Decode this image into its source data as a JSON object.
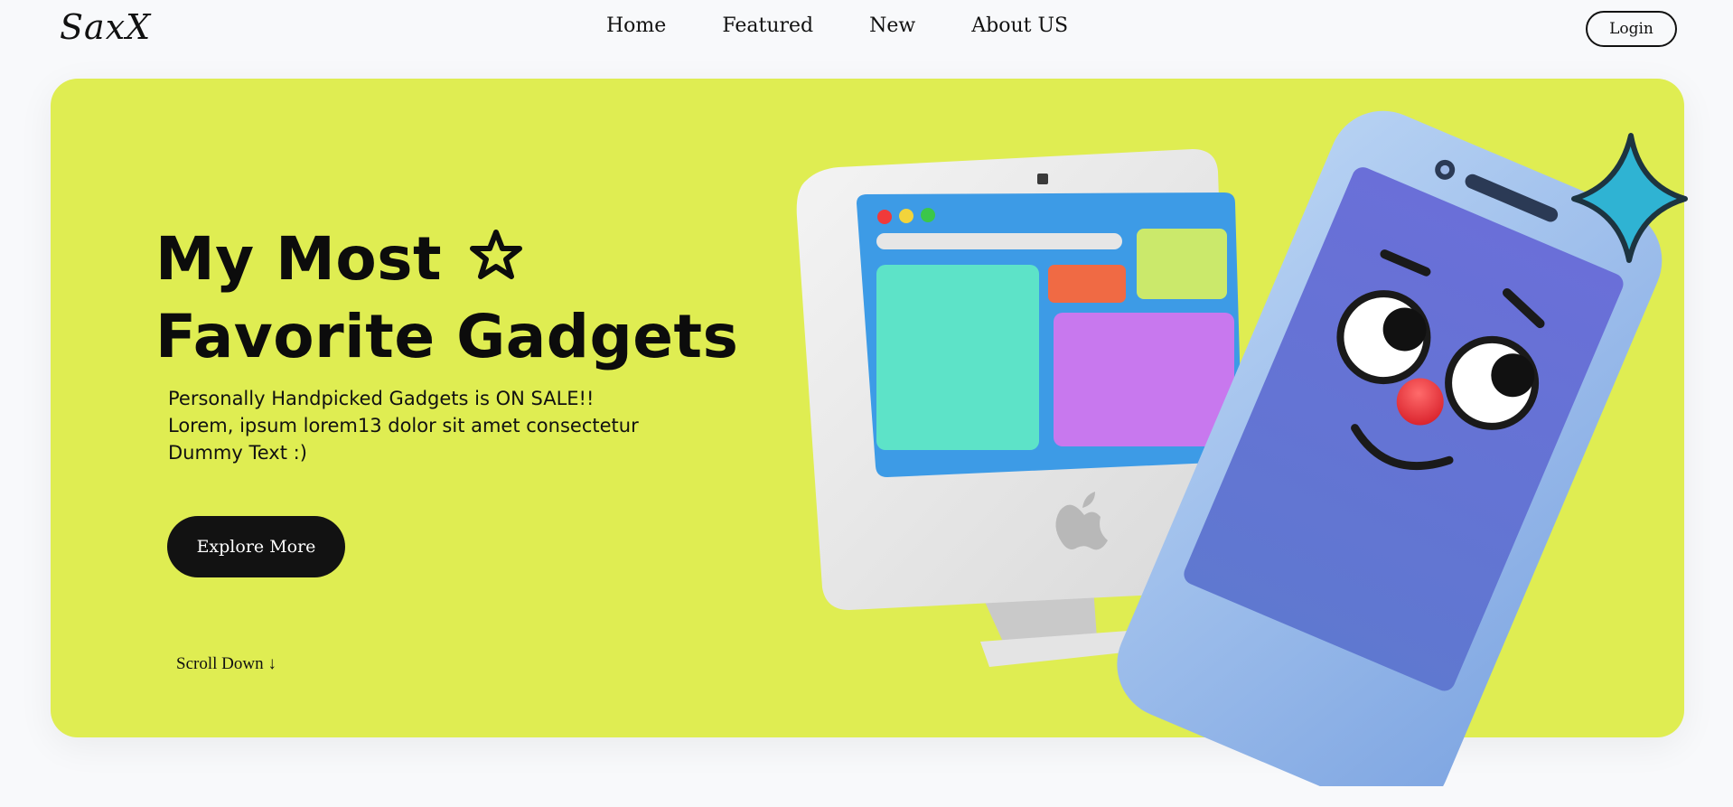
{
  "nav": {
    "logo": "SaxX",
    "links": [
      "Home",
      "Featured",
      "New",
      "About US"
    ],
    "login_label": "Login"
  },
  "hero": {
    "title_line1": "My Most",
    "title_line2": "Favorite Gadgets",
    "subtitle_lines": [
      "Personally Handpicked Gadgets is ON SALE!!",
      "Lorem, ipsum lorem13 dolor sit amet consectetur",
      "Dummy Text :)"
    ],
    "explore_label": "Explore More",
    "scroll_label": "Scroll Down ↓",
    "title_icon": "star-outline-icon",
    "illustration": "monitor-and-smiling-phone-illustration"
  },
  "colors": {
    "page_bg": "#f8f9fb",
    "hero_bg": "#dfed52",
    "button_bg": "#121212",
    "text": "#0c0c0c",
    "phone_body": "#9dc0ec",
    "phone_screen": "#6670d6",
    "monitor_screen": "#3d9be6",
    "sparkle": "#2fb3d3"
  }
}
